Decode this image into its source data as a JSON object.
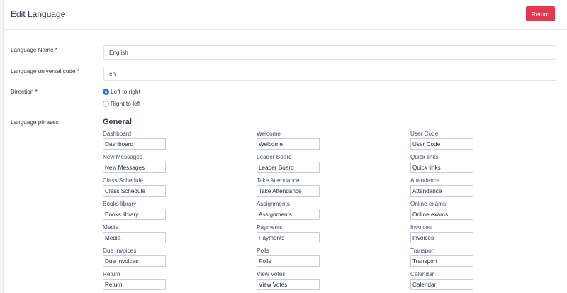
{
  "header": {
    "title": "Edit Language",
    "return_label": "Return"
  },
  "form": {
    "name_label": "Language Name *",
    "name_value": "English",
    "code_label": "Language universal code *",
    "code_value": "en",
    "direction_label": "Direction *",
    "direction_options": [
      "Left to right",
      "Right to left"
    ],
    "direction_selected": "Left to right",
    "phrases_label": "Language phrases"
  },
  "phrases": {
    "section_title": "General",
    "items": [
      {
        "label": "Dashboard",
        "value": "Dashboard"
      },
      {
        "label": "Welcome",
        "value": "Welcome"
      },
      {
        "label": "User Code",
        "value": "User Code"
      },
      {
        "label": "New Messages",
        "value": "New Messages"
      },
      {
        "label": "Leader Board",
        "value": "Leader Board"
      },
      {
        "label": "Quick links",
        "value": "Quick links"
      },
      {
        "label": "Class Schedule",
        "value": "Class Schedule"
      },
      {
        "label": "Take Attendance",
        "value": "Take Attendance"
      },
      {
        "label": "Attendance",
        "value": "Attendance"
      },
      {
        "label": "Books library",
        "value": "Books library"
      },
      {
        "label": "Assignments",
        "value": "Assignments"
      },
      {
        "label": "Online exams",
        "value": "Online exams"
      },
      {
        "label": "Media",
        "value": "Media"
      },
      {
        "label": "Payments",
        "value": "Payments"
      },
      {
        "label": "Invoices",
        "value": "Invoices"
      },
      {
        "label": "Due Invoices",
        "value": "Due Invoices"
      },
      {
        "label": "Polls",
        "value": "Polls"
      },
      {
        "label": "Transport",
        "value": "Transport"
      },
      {
        "label": "Return",
        "value": "Return"
      },
      {
        "label": "View Votes",
        "value": "View Votes"
      },
      {
        "label": "Calendar",
        "value": "Calendar"
      }
    ]
  },
  "colors": {
    "accent": "#e5384f",
    "radio_selected": "#2c7be5",
    "phrase_label": "#3d5068"
  }
}
